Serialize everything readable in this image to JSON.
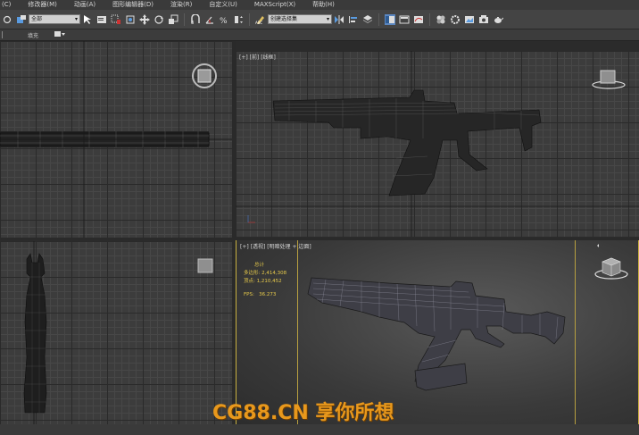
{
  "menu": [
    "(C)",
    "修改器(M)",
    "动画(A)",
    "图形编辑器(D)",
    "渲染(R)",
    "自定义(U)",
    "MAXScript(X)",
    "帮助(H)"
  ],
  "toolbar": {
    "selection_filter": "全部",
    "named_selection": "创建选择集"
  },
  "subbar": {
    "label": "填充"
  },
  "viewports": {
    "top_left": {
      "label": ""
    },
    "top_right": {
      "label": "[+] [前] [线框]"
    },
    "bottom_left": {
      "label": ""
    },
    "bottom_right": {
      "label": "[+] [透视] [明暗处理 + 边面]"
    }
  },
  "stats": {
    "header": "总计",
    "polys_label": "多边形:",
    "polys_value": "2,414,308",
    "verts_label": "顶点:",
    "verts_value": "1,210,452",
    "fps_label": "FPS:",
    "fps_value": "36.273"
  },
  "watermark": "CG88.CN 享你所想",
  "colors": {
    "active_border": "#c8b040",
    "watermark": "#e8981c",
    "stats": "#e6c94a"
  }
}
